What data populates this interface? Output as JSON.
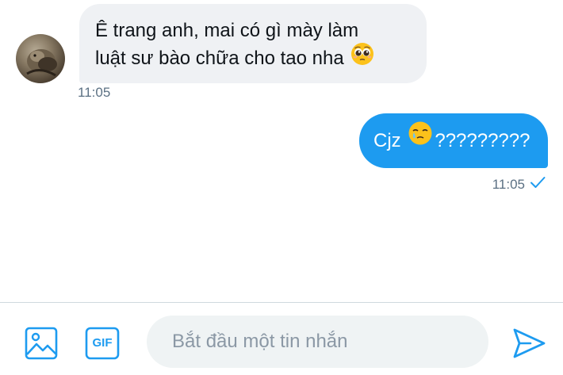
{
  "conversation": {
    "incoming": {
      "lines": [
        "Ê trang anh, mai có gì mày làm",
        "luật sư bào chữa cho tao nha"
      ],
      "emoji": "pleading-face",
      "time": "11:05"
    },
    "outgoing": {
      "text_before": "Cjz",
      "emoji": "face-holding-back-tears",
      "text_after": "?????????",
      "time": "11:05",
      "status": "sent-check"
    }
  },
  "composer": {
    "placeholder": "Bắt đầu một tin nhắn",
    "gif_label": "GIF",
    "value": ""
  },
  "colors": {
    "accent": "#1d9bf0",
    "incoming_bubble": "#eff1f4",
    "timestamp": "#5b7083"
  }
}
